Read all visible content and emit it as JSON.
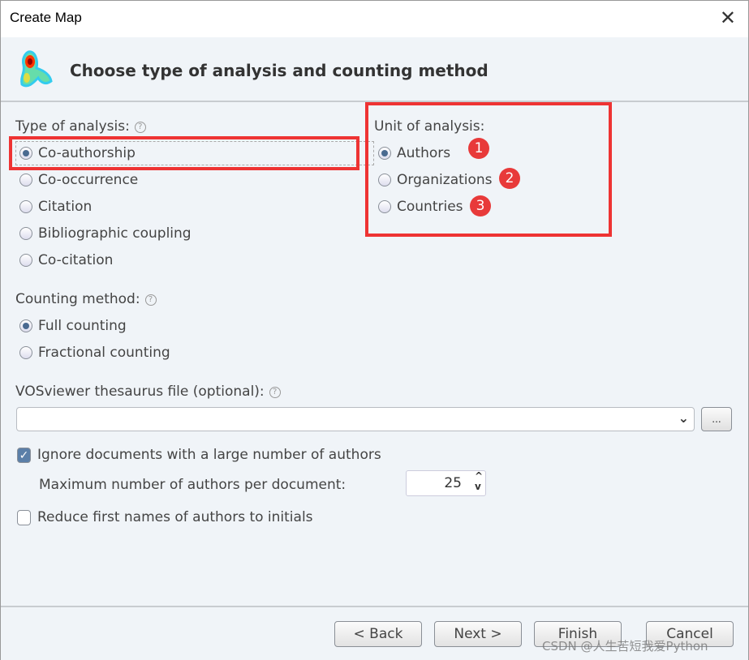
{
  "window": {
    "title": "Create Map",
    "close_icon": "close-icon"
  },
  "header": {
    "title": "Choose type of analysis and counting method",
    "logo_icon": "vosviewer-logo"
  },
  "type_of_analysis": {
    "label": "Type of analysis:",
    "options": [
      {
        "label": "Co-authorship",
        "selected": true
      },
      {
        "label": "Co-occurrence",
        "selected": false
      },
      {
        "label": "Citation",
        "selected": false
      },
      {
        "label": "Bibliographic coupling",
        "selected": false
      },
      {
        "label": "Co-citation",
        "selected": false
      }
    ]
  },
  "unit_of_analysis": {
    "label": "Unit of analysis:",
    "options": [
      {
        "label": "Authors",
        "selected": true,
        "badge": "1"
      },
      {
        "label": "Organizations",
        "selected": false,
        "badge": "2"
      },
      {
        "label": "Countries",
        "selected": false,
        "badge": "3"
      }
    ]
  },
  "counting_method": {
    "label": "Counting method:",
    "options": [
      {
        "label": "Full counting",
        "selected": true
      },
      {
        "label": "Fractional counting",
        "selected": false
      }
    ]
  },
  "thesaurus": {
    "label": "VOSviewer thesaurus file (optional):",
    "value": "",
    "browse_label": "..."
  },
  "ignore_docs": {
    "label": "Ignore documents with a large number of authors",
    "checked": true
  },
  "max_authors": {
    "label": "Maximum number of authors per document:",
    "value": "25"
  },
  "reduce_names": {
    "label": "Reduce first names of authors to initials",
    "checked": false
  },
  "buttons": {
    "back": "< Back",
    "next": "Next >",
    "finish": "Finish",
    "cancel": "Cancel"
  },
  "watermark": "CSDN @人生苦短我爱Python",
  "colors": {
    "highlight": "#ee3333",
    "radio_selected": "#4a6a90"
  }
}
